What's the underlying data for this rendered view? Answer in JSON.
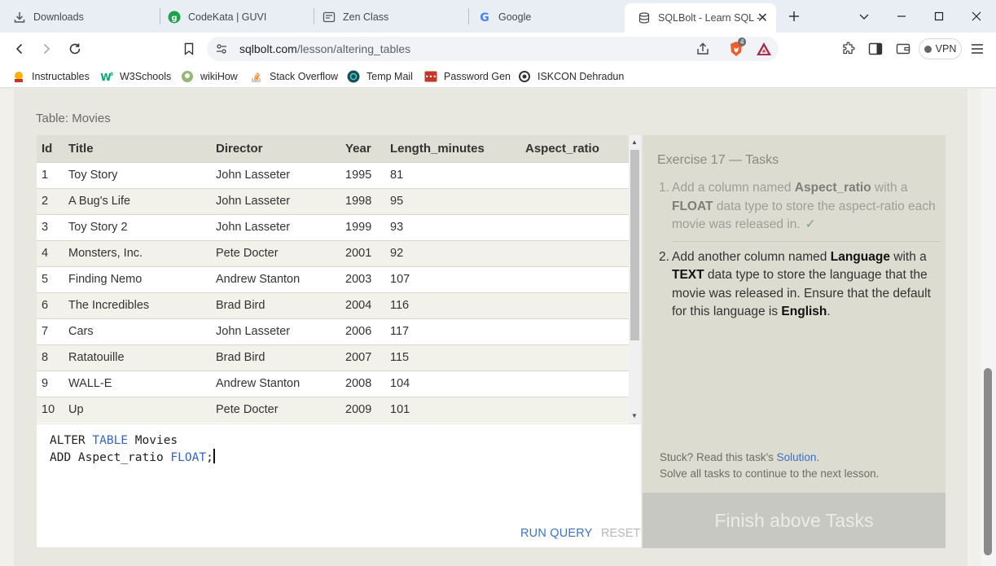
{
  "browser": {
    "tabs": [
      {
        "label": "Downloads",
        "icon": "download-icon"
      },
      {
        "label": "CodeKata | GUVI",
        "icon": "guvi-icon"
      },
      {
        "label": "Zen Class",
        "icon": "zen-class-icon"
      },
      {
        "label": "Google",
        "icon": "google-icon"
      },
      {
        "label": "SQLBolt - Learn SQL -",
        "icon": "sqlbolt-icon",
        "active": true
      }
    ],
    "url_host": "sqlbolt.com",
    "url_path": "/lesson/altering_tables",
    "brave_badge": "4",
    "vpn_label": "VPN",
    "bookmarks": [
      {
        "label": "Instructables",
        "icon": "instructables-icon"
      },
      {
        "label": "W3Schools",
        "icon": "w3schools-icon"
      },
      {
        "label": "wikiHow",
        "icon": "wikihow-icon"
      },
      {
        "label": "Stack Overflow",
        "icon": "stackoverflow-icon"
      },
      {
        "label": "Temp Mail",
        "icon": "temp-mail-icon"
      },
      {
        "label": "Password Gen",
        "icon": "password-gen-icon"
      },
      {
        "label": "ISKCON Dehradun",
        "icon": "iskcon-icon"
      }
    ]
  },
  "lesson": {
    "table_label": "Table: Movies",
    "columns": [
      "Id",
      "Title",
      "Director",
      "Year",
      "Length_minutes",
      "Aspect_ratio"
    ],
    "rows": [
      [
        "1",
        "Toy Story",
        "John Lasseter",
        "1995",
        "81",
        ""
      ],
      [
        "2",
        "A Bug's Life",
        "John Lasseter",
        "1998",
        "95",
        ""
      ],
      [
        "3",
        "Toy Story 2",
        "John Lasseter",
        "1999",
        "93",
        ""
      ],
      [
        "4",
        "Monsters, Inc.",
        "Pete Docter",
        "2001",
        "92",
        ""
      ],
      [
        "5",
        "Finding Nemo",
        "Andrew Stanton",
        "2003",
        "107",
        ""
      ],
      [
        "6",
        "The Incredibles",
        "Brad Bird",
        "2004",
        "116",
        ""
      ],
      [
        "7",
        "Cars",
        "John Lasseter",
        "2006",
        "117",
        ""
      ],
      [
        "8",
        "Ratatouille",
        "Brad Bird",
        "2007",
        "115",
        ""
      ],
      [
        "9",
        "WALL-E",
        "Andrew Stanton",
        "2008",
        "104",
        ""
      ],
      [
        "10",
        "Up",
        "Pete Docter",
        "2009",
        "101",
        ""
      ]
    ],
    "editor": {
      "line1_a": "ALTER ",
      "line1_kw": "TABLE",
      "line1_b": " Movies",
      "line2_a": "ADD Aspect_ratio ",
      "line2_kw": "FLOAT",
      "line2_b": ";"
    },
    "run_label": "RUN QUERY",
    "reset_label": "RESET",
    "tasks": {
      "title": "Exercise 17 — Tasks",
      "task1_num": "1.",
      "task1_a": "Add a column named ",
      "task1_b1": "Aspect_ratio",
      "task1_c": " with a ",
      "task1_b2": "FLOAT",
      "task1_d": " data type to store the aspect-ratio each movie was released in.",
      "task1_check": "✓",
      "task2_num": "2.",
      "task2_a": "Add another column named ",
      "task2_b1": "Language",
      "task2_c": " with a ",
      "task2_b2": "TEXT",
      "task2_d": " data type to store the language that the movie was released in. Ensure that the default for this language is ",
      "task2_b3": "English",
      "task2_e": ".",
      "stuck_a": "Stuck? Read this task's ",
      "stuck_link": "Solution",
      "stuck_b": ".",
      "stuck_line2": "Solve all tasks to continue to the next lesson.",
      "finish_label": "Finish above Tasks"
    }
  }
}
